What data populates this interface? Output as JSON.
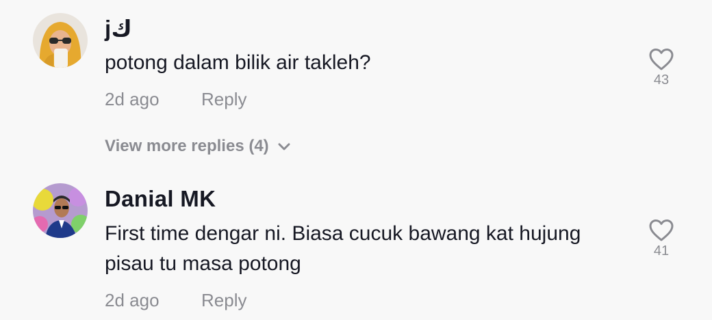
{
  "comments": [
    {
      "author": "jك",
      "text": "potong dalam bilik air takleh?",
      "time": "2d ago",
      "reply_label": "Reply",
      "likes": "43",
      "avatar_icon": "avatar-woman-yellow-hijab"
    },
    {
      "author": "Danial MK",
      "text": "First time dengar ni. Biasa cucuk bawang kat hujung pisau tu masa potong",
      "time": "2d ago",
      "reply_label": "Reply",
      "likes": "41",
      "avatar_icon": "avatar-man-sunglasses"
    }
  ],
  "view_more_replies": "View more replies (4)",
  "colors": {
    "background": "#f8f8f8",
    "primary_text": "#161823",
    "secondary_text": "#8a8b91"
  }
}
